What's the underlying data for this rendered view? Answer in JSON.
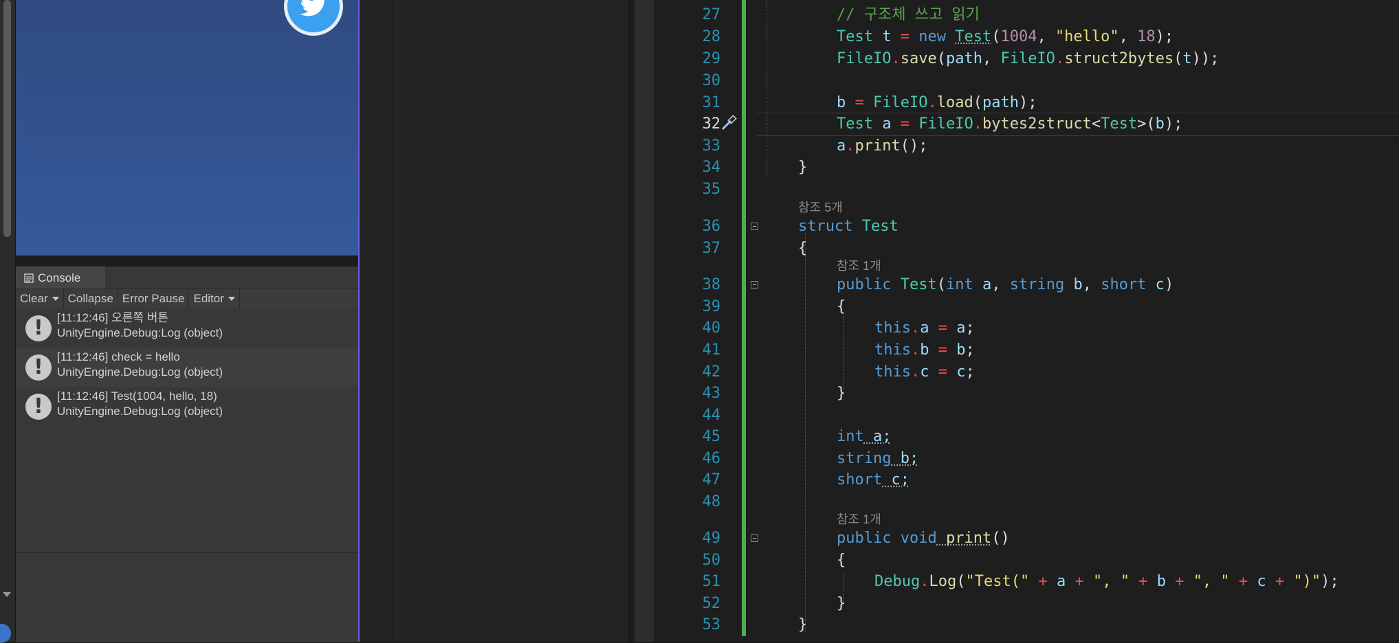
{
  "console": {
    "tab_label": "Console",
    "toolbar": {
      "clear": "Clear",
      "collapse": "Collapse",
      "error_pause": "Error Pause",
      "editor": "Editor"
    },
    "logs": [
      {
        "line1": "[11:12:46] 오른쪽 버튼",
        "line2": "UnityEngine.Debug:Log (object)"
      },
      {
        "line1": "[11:12:46] check = hello",
        "line2": "UnityEngine.Debug:Log (object)"
      },
      {
        "line1": "[11:12:46] Test(1004, hello, 18)",
        "line2": "UnityEngine.Debug:Log (object)"
      }
    ]
  },
  "editor": {
    "line_numbers": [
      "27",
      "28",
      "29",
      "30",
      "31",
      "32",
      "33",
      "34",
      "35",
      "36",
      "37",
      "38",
      "39",
      "40",
      "41",
      "42",
      "43",
      "44",
      "45",
      "46",
      "47",
      "48",
      "49",
      "50",
      "51",
      "52",
      "53"
    ],
    "references": {
      "struct_refs": "참조 5개",
      "ctor_refs": "참조 1개",
      "print_refs": "참조 1개"
    },
    "code": {
      "l27": "// 구조체 쓰고 읽기",
      "l28_a": "Test",
      "l28_b": " t ",
      "l28_c": "=",
      "l28_d": " new ",
      "l28_e": "Test",
      "l28_f": "(",
      "l28_g": "1004",
      "l28_h": ", ",
      "l28_i": "\"hello\"",
      "l28_j": ", ",
      "l28_k": "18",
      "l28_l": ");",
      "l29_a": "FileIO",
      "l29_b": ".",
      "l29_c": "save",
      "l29_d": "(",
      "l29_e": "path",
      "l29_f": ", ",
      "l29_g": "FileIO",
      "l29_h": ".",
      "l29_i": "struct2bytes",
      "l29_j": "(",
      "l29_k": "t",
      "l29_l": "));",
      "l31_a": "b",
      "l31_b": " = ",
      "l31_c": "FileIO",
      "l31_d": ".",
      "l31_e": "load",
      "l31_f": "(",
      "l31_g": "path",
      "l31_h": ");",
      "l32_a": "Test",
      "l32_b": " a ",
      "l32_c": "=",
      "l32_d": " FileIO",
      "l32_e": ".",
      "l32_f": "bytes2struct",
      "l32_g": "<",
      "l32_h": "Test",
      "l32_i": ">(",
      "l32_j": "b",
      "l32_k": ");",
      "l33_a": "a",
      "l33_b": ".",
      "l33_c": "print",
      "l33_d": "();",
      "l34": "}",
      "l36_a": "struct",
      "l36_b": " Test",
      "l37": "{",
      "l38_a": "public",
      "l38_b": " Test",
      "l38_c": "(",
      "l38_d": "int",
      "l38_e": " a",
      "l38_f": ", ",
      "l38_g": "string",
      "l38_h": " b",
      "l38_i": ", ",
      "l38_j": "short",
      "l38_k": " c",
      "l38_l": ")",
      "l39": "{",
      "l40_a": "this",
      "l40_b": ".",
      "l40_c": "a",
      "l40_d": " = ",
      "l40_e": "a",
      "l40_f": ";",
      "l41_a": "this",
      "l41_b": ".",
      "l41_c": "b",
      "l41_d": " = ",
      "l41_e": "b",
      "l41_f": ";",
      "l42_a": "this",
      "l42_b": ".",
      "l42_c": "c",
      "l42_d": " = ",
      "l42_e": "c",
      "l42_f": ";",
      "l43": "}",
      "l45_a": "int",
      "l45_b": " a;",
      "l46_a": "string",
      "l46_b": " b;",
      "l47_a": "short",
      "l47_b": " c;",
      "l49_a": "public",
      "l49_b": " void",
      "l49_c": " print",
      "l49_d": "()",
      "l50": "{",
      "l51_a": "Debug",
      "l51_b": ".",
      "l51_c": "Log",
      "l51_d": "(",
      "l51_e": "\"Test(\"",
      "l51_f": " + ",
      "l51_g": "a",
      "l51_h": " + ",
      "l51_i": "\", \"",
      "l51_j": " + ",
      "l51_k": "b",
      "l51_l": " + ",
      "l51_m": "\", \"",
      "l51_n": " + ",
      "l51_o": "c",
      "l51_p": " + ",
      "l51_q": "\")\"",
      "l51_r": ");",
      "l52": "}",
      "l53": "}"
    }
  },
  "colors": {
    "change_bar": "#4caf50",
    "game_view_bg": "#35599a",
    "twitter_blue": "#3aa0ef"
  }
}
